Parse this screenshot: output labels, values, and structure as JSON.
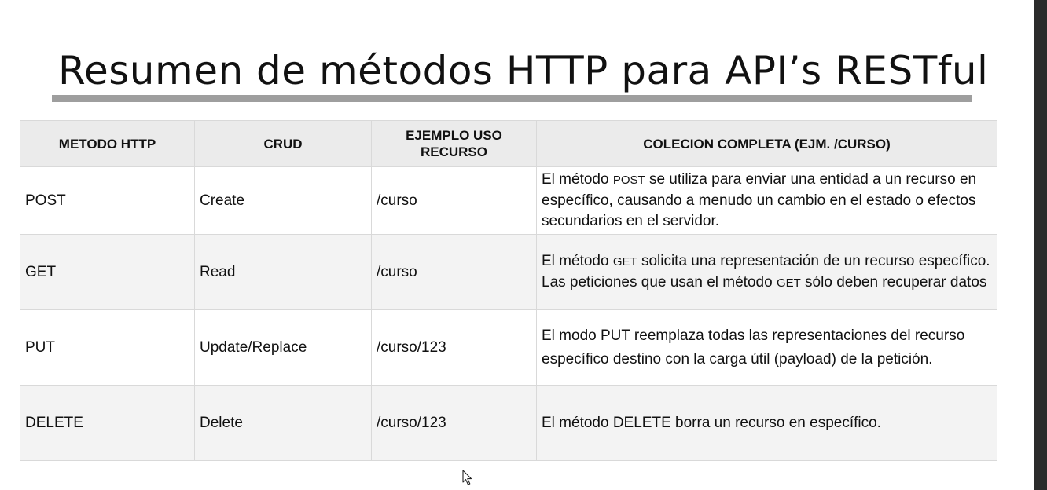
{
  "slide": {
    "title": "Resumen de métodos HTTP para API’s RESTful"
  },
  "table": {
    "headers": {
      "method": "METODO HTTP",
      "crud": "CRUD",
      "example": "EJEMPLO USO RECURSO",
      "collection": "COLECION COMPLETA (EJM. /CURSO)"
    },
    "rows": [
      {
        "method": "POST",
        "crud": "Create",
        "example": "/curso",
        "desc_pre": "El método ",
        "desc_code": "POST",
        "desc_post": " se utiliza para enviar una entidad a un recurso en específico, causando a menudo un cambio en el estado o efectos secundarios en el servidor."
      },
      {
        "method": "GET",
        "crud": "Read",
        "example": "/curso",
        "desc_pre": "El método ",
        "desc_code": "GET",
        "desc_mid": "  solicita una representación de un recurso específico. Las peticiones que usan el método ",
        "desc_code2": "GET",
        "desc_post": " sólo deben recuperar datos"
      },
      {
        "method": "PUT",
        "crud": "Update/Replace",
        "example": "/curso/123",
        "desc_pre": "El modo ",
        "desc_code": "PUT",
        "desc_post": " reemplaza todas las representaciones del recurso específico destino con la carga útil (payload) de la petición."
      },
      {
        "method": "DELETE",
        "crud": "Delete",
        "example": "/curso/123",
        "desc_pre": "El método ",
        "desc_code": "DELETE",
        "desc_post": " borra un recurso en específico."
      }
    ]
  },
  "icons": {
    "cursor": "mouse-pointer-icon"
  }
}
